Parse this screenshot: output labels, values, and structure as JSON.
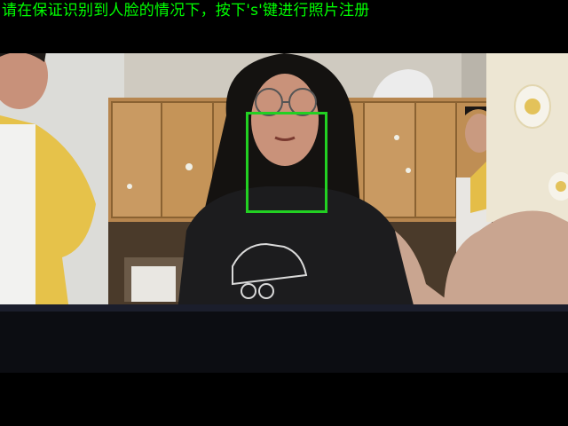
{
  "window": {
    "instruction_text": "请在保证识别到人脸的情况下，按下's'键进行照片注册"
  },
  "overlay": {
    "text_color": "#00ff00",
    "face_box_color": "#22d022"
  },
  "icons": {
    "camera_scene": "webcam-feed-image",
    "face_detection": "face-bounding-box"
  }
}
